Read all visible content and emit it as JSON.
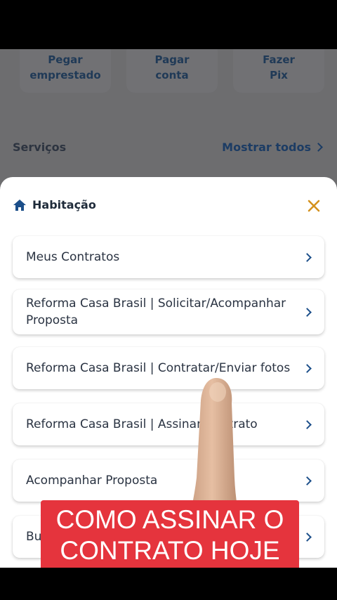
{
  "quick_actions": [
    {
      "line1": "Pegar",
      "line2": "emprestado"
    },
    {
      "line1": "Pagar",
      "line2": "conta"
    },
    {
      "line1": "Fazer",
      "line2": "Pix"
    }
  ],
  "services": {
    "title": "Serviços",
    "show_all": "Mostrar todos"
  },
  "sheet": {
    "title": "Habitação",
    "icon": "home-icon",
    "close_icon": "close-icon",
    "items": [
      {
        "label": "Meus Contratos"
      },
      {
        "label": "Reforma Casa Brasil | Solicitar/Acompanhar Proposta"
      },
      {
        "label": "Reforma Casa Brasil | Contratar/Enviar fotos"
      },
      {
        "label": "Reforma Casa Brasil | Assinar Contrato"
      },
      {
        "label": "Acompanhar Proposta"
      },
      {
        "label": "Bu"
      }
    ]
  },
  "overlay_caption": {
    "line1": "COMO ASSINAR O",
    "line2": "CONTRATO HOJE"
  },
  "colors": {
    "brand_blue": "#1c4f8a",
    "caption_red": "#e5343d",
    "close_orange": "#d4921e"
  }
}
